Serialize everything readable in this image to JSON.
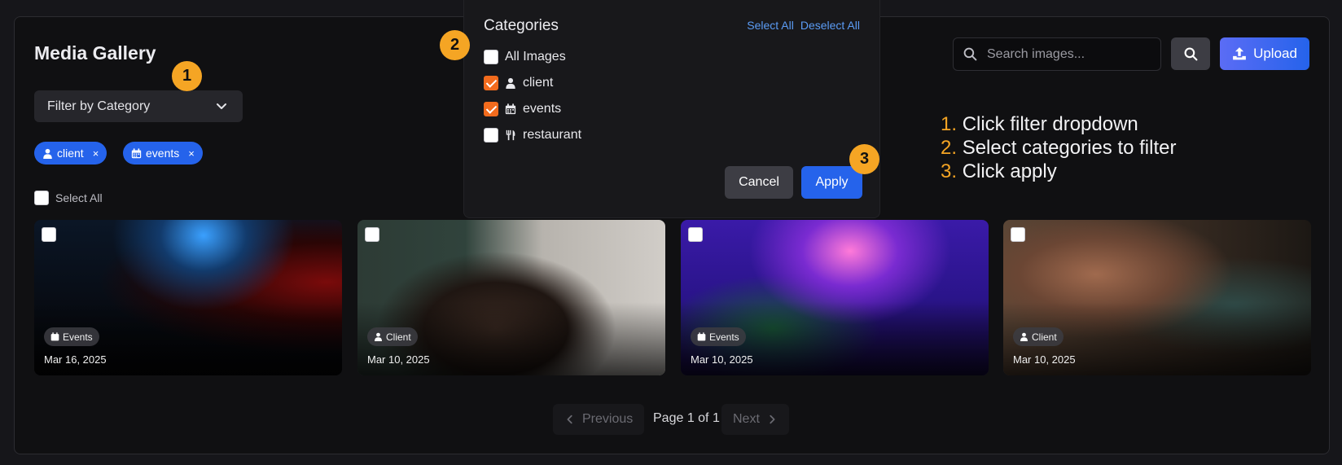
{
  "page": {
    "title": "Media Gallery"
  },
  "filter": {
    "label": "Filter by Category"
  },
  "chips": [
    {
      "label": "client",
      "icon": "user-icon",
      "remove": "×"
    },
    {
      "label": "events",
      "icon": "calendar-icon",
      "remove": "×"
    }
  ],
  "select_all_label": "Select All",
  "cards": [
    {
      "tag": "Events",
      "tag_icon": "calendar-icon",
      "date": "Mar 16, 2025"
    },
    {
      "tag": "Client",
      "tag_icon": "user-icon",
      "date": "Mar 10, 2025"
    },
    {
      "tag": "Events",
      "tag_icon": "calendar-icon",
      "date": "Mar 10, 2025"
    },
    {
      "tag": "Client",
      "tag_icon": "user-icon",
      "date": "Mar 10, 2025"
    }
  ],
  "pagination": {
    "previous": "Previous",
    "info": "Page 1 of 1",
    "next": "Next"
  },
  "search": {
    "placeholder": "Search images..."
  },
  "upload": {
    "label": "Upload"
  },
  "dropdown": {
    "title": "Categories",
    "select_all": "Select All",
    "deselect_all": "Deselect All",
    "options": [
      {
        "label": "All Images",
        "checked": false,
        "icon": ""
      },
      {
        "label": "client",
        "checked": true,
        "icon": "user-icon"
      },
      {
        "label": "events",
        "checked": true,
        "icon": "calendar-icon"
      },
      {
        "label": "restaurant",
        "checked": false,
        "icon": "utensils-icon"
      }
    ],
    "cancel": "Cancel",
    "apply": "Apply"
  },
  "steps": [
    "1",
    "2",
    "3"
  ],
  "instructions": [
    {
      "num": "1.",
      "text": "Click filter dropdown"
    },
    {
      "num": "2.",
      "text": "Select categories to filter"
    },
    {
      "num": "3.",
      "text": "Click apply"
    }
  ],
  "colors": {
    "accent": "#2563eb",
    "badge": "#f5a524",
    "checkbox": "#f26b1d",
    "link": "#5b9cf5"
  }
}
